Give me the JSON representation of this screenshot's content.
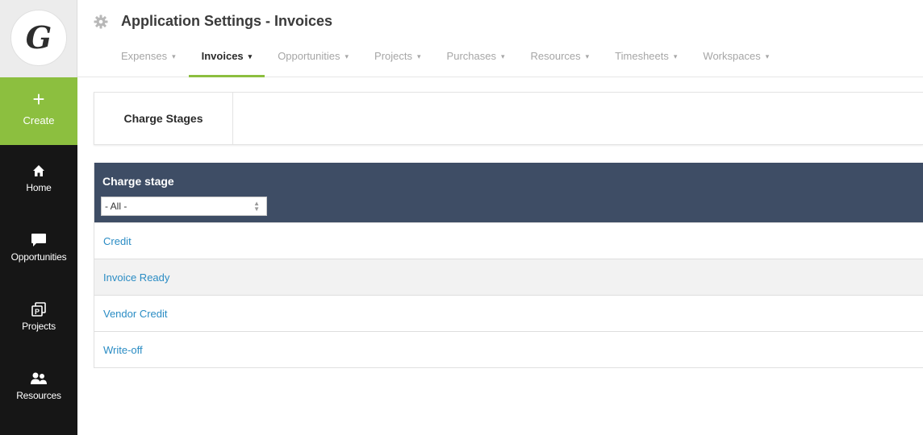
{
  "sidebar": {
    "logo_letter": "G",
    "create_label": "Create",
    "items": [
      {
        "label": "Home",
        "icon": "home-icon"
      },
      {
        "label": "Opportunities",
        "icon": "chat-bubble-icon"
      },
      {
        "label": "Projects",
        "icon": "projects-icon"
      },
      {
        "label": "Resources",
        "icon": "people-icon"
      }
    ]
  },
  "header": {
    "title": "Application Settings - Invoices",
    "title_icon": "gear-icon",
    "tabs": [
      {
        "label": "Expenses",
        "active": false
      },
      {
        "label": "Invoices",
        "active": true
      },
      {
        "label": "Opportunities",
        "active": false
      },
      {
        "label": "Projects",
        "active": false
      },
      {
        "label": "Purchases",
        "active": false
      },
      {
        "label": "Resources",
        "active": false
      },
      {
        "label": "Timesheets",
        "active": false
      },
      {
        "label": "Workspaces",
        "active": false
      }
    ],
    "caret": "▾"
  },
  "subnav": {
    "tab_label": "Charge Stages"
  },
  "table": {
    "column_header": "Charge stage",
    "filter_value": "- All -",
    "rows": [
      "Credit",
      "Invoice Ready",
      "Vendor Credit",
      "Write-off"
    ]
  },
  "colors": {
    "accent_green": "#8cbf3f",
    "sidebar_bg": "#161616",
    "table_header_bg": "#3e4d65",
    "link_blue": "#2a8cc4"
  }
}
